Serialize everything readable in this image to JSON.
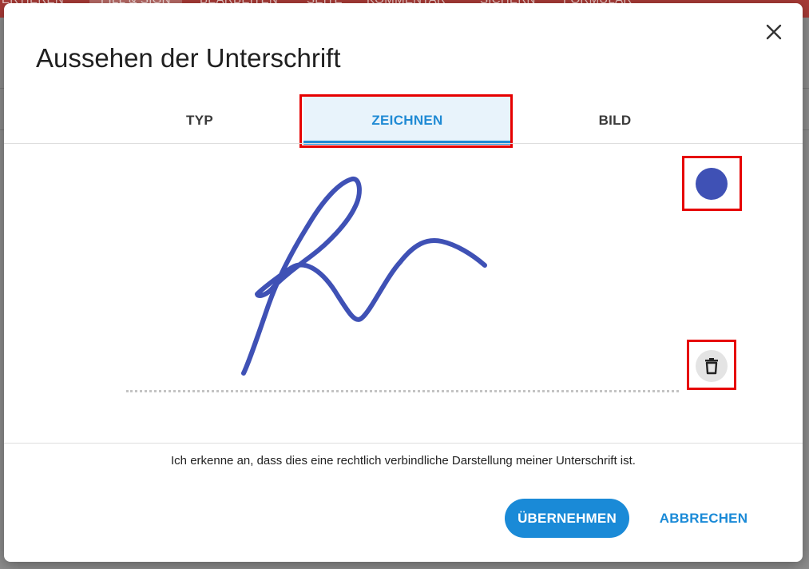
{
  "background_app": {
    "toolbar_tabs": [
      "ERTIEREN",
      "FILL & SIGN",
      "BEARBEITEN",
      "SEITE",
      "KOMMENTAR",
      "SICHERN",
      "FORMULAR"
    ],
    "active_tab_index": 1
  },
  "dialog": {
    "title": "Aussehen der Unterschrift",
    "close_icon": "close-icon",
    "tabs": [
      {
        "label": "TYP",
        "active": false
      },
      {
        "label": "ZEICHNEN",
        "active": true
      },
      {
        "label": "BILD",
        "active": false
      }
    ],
    "ink_color": "#3f51b5",
    "color_picker_icon": "color-dot-icon",
    "delete_icon": "trash-icon",
    "consent_text": "Ich erkenne an, dass dies eine rechtlich verbindliche Darstellung meiner Unterschrift ist.",
    "apply_label": "ÜBERNEHMEN",
    "cancel_label": "ABBRECHEN"
  },
  "colors": {
    "accent": "#1a8ad7",
    "highlight": "#e60000",
    "toolbar": "#a83a36"
  }
}
